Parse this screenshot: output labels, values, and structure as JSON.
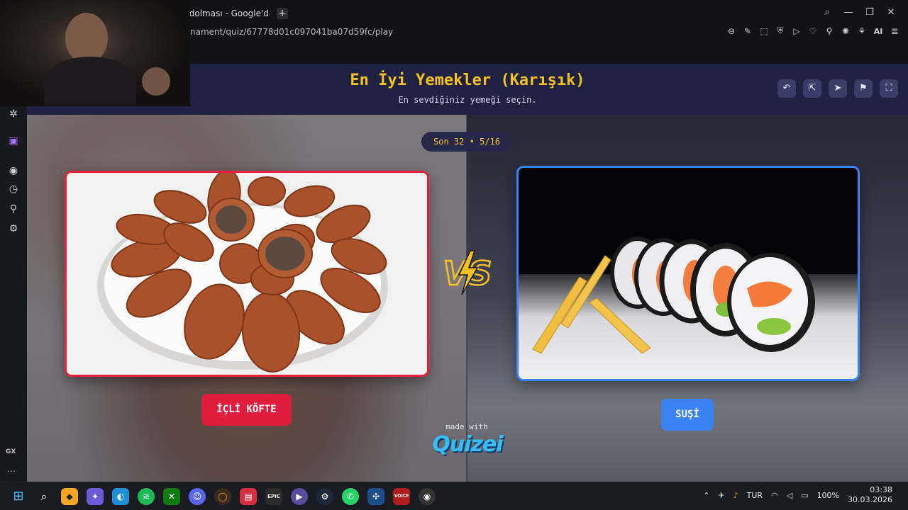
{
  "browser": {
    "tab_title": "r dolması - Google'da",
    "url": "nament/quiz/67778d01c097041ba07d59fc/play",
    "ext_ai_label": "AI"
  },
  "quiz": {
    "title": "En İyi Yemekler (Karışık)",
    "subtitle": "En sevdiğiniz yemeği seçin.",
    "round_label": "Son 32 • 5/16",
    "vs_label": "VS",
    "left": {
      "label": "İÇLİ KÖFTE"
    },
    "right": {
      "label": "SUŞİ"
    },
    "made_with": "made with",
    "brand": "Quizei"
  },
  "sidebar": {
    "gx_label": "GX"
  },
  "taskbar": {
    "language": "TUR",
    "battery": "100%",
    "time": "03:38",
    "date": "30.03.2026"
  },
  "colors": {
    "accent_yellow": "#f5c022",
    "left_red": "#e11d3f",
    "right_blue": "#3b82f6",
    "header_bg": "#1f2140"
  }
}
